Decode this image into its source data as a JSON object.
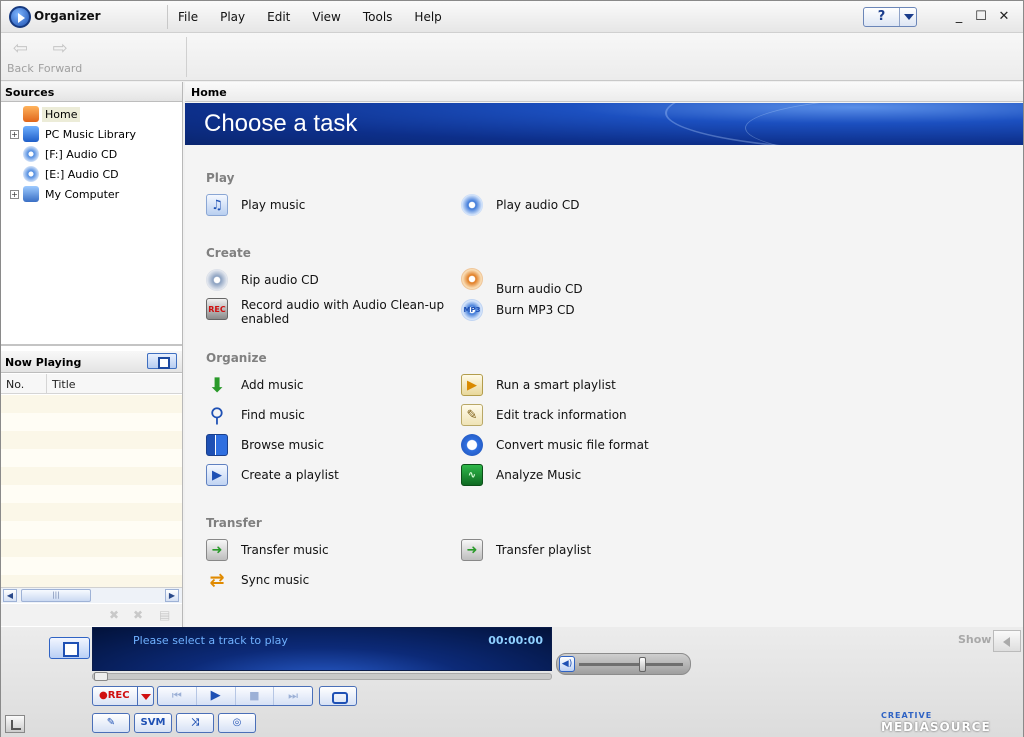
{
  "app": {
    "title": "Organizer"
  },
  "menu": [
    "File",
    "Play",
    "Edit",
    "View",
    "Tools",
    "Help"
  ],
  "window_controls": {
    "help": "?",
    "minimize": "_",
    "maximize": "☐",
    "close": "✕"
  },
  "toolbar": {
    "back": "Back",
    "forward": "Forward"
  },
  "sources": {
    "header": "Sources",
    "items": [
      {
        "label": "Home",
        "icon": "home-icon",
        "expandable": false,
        "selected": true
      },
      {
        "label": "PC Music Library",
        "icon": "music-library-icon",
        "expandable": true
      },
      {
        "label": "[F:] Audio CD",
        "icon": "audio-cd-icon",
        "expandable": false
      },
      {
        "label": "[E:] Audio CD",
        "icon": "audio-cd-icon",
        "expandable": false
      },
      {
        "label": "My Computer",
        "icon": "computer-icon",
        "expandable": true
      }
    ]
  },
  "now_playing": {
    "header": "Now Playing",
    "columns": [
      "No.",
      "Title"
    ],
    "scroll_thumb": "|||"
  },
  "main": {
    "breadcrumb": "Home",
    "banner_title": "Choose a task",
    "sections": [
      {
        "title": "Play",
        "tasks": [
          {
            "label": "Play music",
            "icon": "play-music-icon"
          },
          {
            "label": "Play audio CD",
            "icon": "play-cd-icon"
          }
        ]
      },
      {
        "title": "Create",
        "tasks": [
          {
            "label": "Rip audio CD",
            "icon": "rip-cd-icon"
          },
          {
            "label": "Burn audio CD",
            "icon": "burn-cd-icon"
          },
          {
            "label": "Record audio with Audio Clean-up enabled",
            "icon": "record-icon"
          },
          {
            "label": "Burn MP3 CD",
            "icon": "burn-mp3-icon"
          }
        ]
      },
      {
        "title": "Organize",
        "tasks": [
          {
            "label": "Add music",
            "icon": "add-music-icon"
          },
          {
            "label": "Run a smart playlist",
            "icon": "smart-playlist-icon"
          },
          {
            "label": "Find music",
            "icon": "search-icon"
          },
          {
            "label": "Edit track information",
            "icon": "edit-track-icon"
          },
          {
            "label": "Browse music",
            "icon": "browse-icon"
          },
          {
            "label": "Convert music file format",
            "icon": "convert-icon"
          },
          {
            "label": "Create a playlist",
            "icon": "create-playlist-icon"
          },
          {
            "label": "Analyze Music",
            "icon": "analyze-icon"
          }
        ]
      },
      {
        "title": "Transfer",
        "tasks": [
          {
            "label": "Transfer music",
            "icon": "transfer-music-icon"
          },
          {
            "label": "Transfer playlist",
            "icon": "transfer-playlist-icon"
          },
          {
            "label": "Sync music",
            "icon": "sync-icon"
          }
        ]
      }
    ]
  },
  "player": {
    "message": "Please select a track to play",
    "time": "00:00:00",
    "show_label": "Show",
    "rec_label": "●REC",
    "svm_label": "SVM",
    "volume": 0.62,
    "brand_top": "CREATIVE",
    "brand_main": "MEDIASOURCE"
  },
  "colors": {
    "banner": "#0d2f8a",
    "accent": "#1e50b4",
    "section_title": "#808080"
  }
}
